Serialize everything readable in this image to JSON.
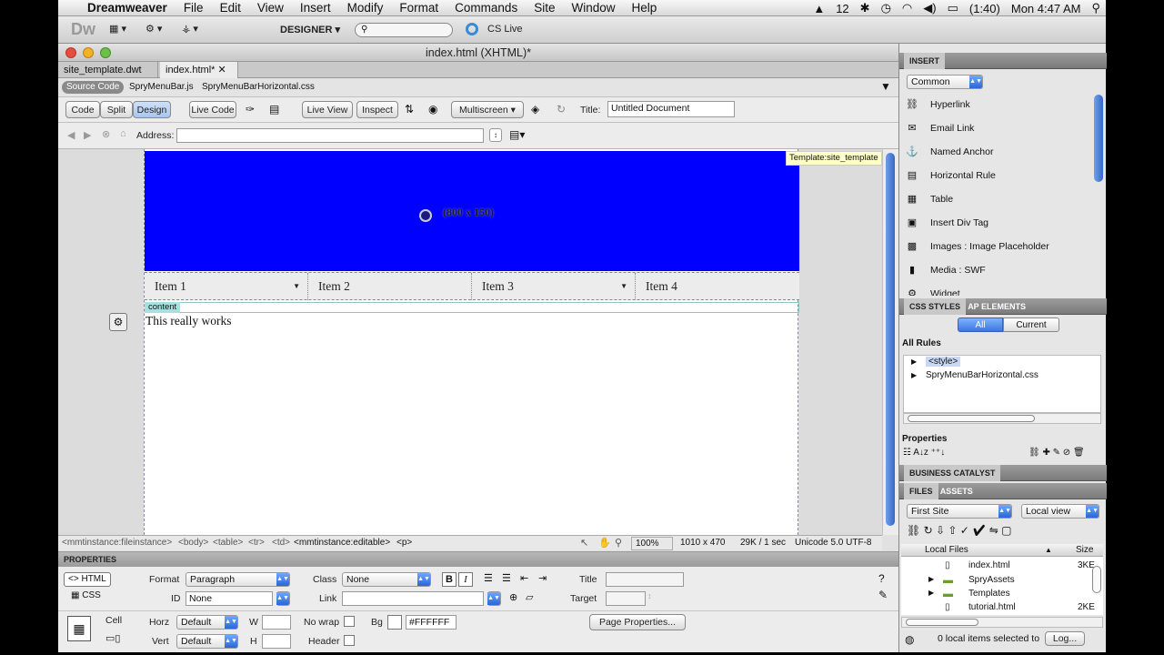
{
  "menubar": {
    "items": [
      "Dreamweaver",
      "File",
      "Edit",
      "View",
      "Insert",
      "Modify",
      "Format",
      "Commands",
      "Site",
      "Window",
      "Help"
    ],
    "status": {
      "adobe_count": "12",
      "battery": "(1:40)",
      "clock": "Mon 4:47 AM"
    }
  },
  "appbar": {
    "logo": "Dw",
    "workspace": "DESIGNER ▾",
    "cs_live": "CS Live"
  },
  "window": {
    "title": "index.html (XHTML)*",
    "tabs": [
      "site_template.dwt",
      "index.html*"
    ],
    "related": [
      "Source Code",
      "SpryMenuBar.js",
      "SpryMenuBarHorizontal.css"
    ]
  },
  "doc_toolbar": {
    "view_buttons": [
      "Code",
      "Split",
      "Design"
    ],
    "live_code": "Live Code",
    "live_view": "Live View",
    "inspect": "Inspect",
    "multiscreen": "Multiscreen",
    "title_label": "Title:",
    "title_value": "Untitled Document"
  },
  "address": {
    "label": "Address:",
    "value": ""
  },
  "design": {
    "template_badge": "Template:site_template",
    "banner_label": "(800 x 150)",
    "menu_items": [
      "Item 1",
      "Item 2",
      "Item 3",
      "Item 4"
    ],
    "region_label": "content",
    "body_text": "This really works"
  },
  "tag_selector": {
    "tags": [
      "<mmtinstance:fileinstance>",
      "<body>",
      "<table>",
      "<tr>",
      "<td>",
      "<mmtinstance:editable>",
      "<p>"
    ],
    "zoom": "100%",
    "size": "1010 x 470",
    "download": "29K / 1 sec",
    "encoding": "Unicode 5.0 UTF-8"
  },
  "properties": {
    "header": "PROPERTIES",
    "html_tab": "HTML",
    "css_tab": "CSS",
    "format_label": "Format",
    "format_value": "Paragraph",
    "id_label": "ID",
    "id_value": "None",
    "class_label": "Class",
    "class_value": "None",
    "link_label": "Link",
    "title_label": "Title",
    "target_label": "Target",
    "bold": "B",
    "italic": "I",
    "cell_label": "Cell",
    "horz_label": "Horz",
    "horz_value": "Default",
    "vert_label": "Vert",
    "vert_value": "Default",
    "w_label": "W",
    "h_label": "H",
    "nowrap_label": "No wrap",
    "header_label": "Header",
    "bg_label": "Bg",
    "bg_value": "#FFFFFF",
    "page_props": "Page Properties..."
  },
  "insert_panel": {
    "header": "INSERT",
    "category": "Common",
    "items": [
      "Hyperlink",
      "Email Link",
      "Named Anchor",
      "Horizontal Rule",
      "Table",
      "Insert Div Tag",
      "Images : Image Placeholder",
      "Media : SWF",
      "Widget"
    ]
  },
  "css_panel": {
    "tabs": [
      "CSS STYLES",
      "AP ELEMENTS"
    ],
    "modes": [
      "All",
      "Current"
    ],
    "all_rules_label": "All Rules",
    "rules": [
      "<style>",
      "SpryMenuBarHorizontal.css"
    ],
    "properties_label": "Properties"
  },
  "bc_panel": {
    "header": "BUSINESS CATALYST"
  },
  "files_panel": {
    "tabs": [
      "FILES",
      "ASSETS"
    ],
    "site": "First Site",
    "view": "Local view",
    "col_name": "Local Files",
    "col_size": "Size",
    "files": [
      {
        "name": "index.html",
        "size": "3KE"
      },
      {
        "name": "SpryAssets",
        "size": ""
      },
      {
        "name": "Templates",
        "size": ""
      },
      {
        "name": "tutorial.html",
        "size": "2KE"
      }
    ],
    "status": "0 local items selected to",
    "log": "Log..."
  }
}
